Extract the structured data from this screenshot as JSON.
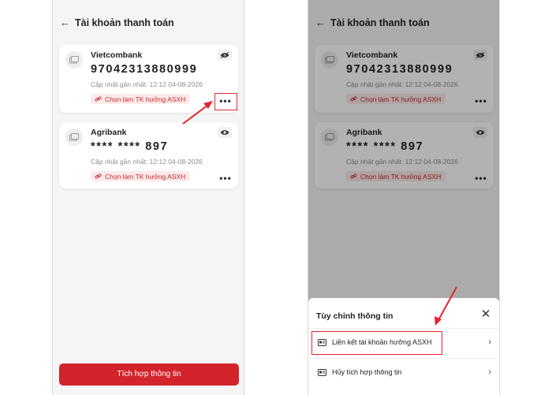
{
  "header": {
    "title": "Tài khoản thanh toán"
  },
  "accounts": [
    {
      "bank": "Vietcombank",
      "number": "9704231388099​9",
      "updated": "Cập nhật gần nhất: 12:12 04-08-2026",
      "asxh_label": "Chọn làm TK hưởng ASXH"
    },
    {
      "bank": "Agribank",
      "number": "**** **** 897",
      "updated": "Cập nhật gần nhất: 12:12 04-08-2026",
      "asxh_label": "Chọn làm TK hưởng ASXH"
    }
  ],
  "primary_button": "Tích hợp thông tin",
  "sheet": {
    "title": "Tùy chỉnh thông tin",
    "items": [
      {
        "label": "Liên kết tài khoản hưởng ASXH"
      },
      {
        "label": "Hủy tích hợp thông tin"
      }
    ]
  },
  "colors": {
    "brand_red": "#d3242b",
    "highlight_red": "#e3262d",
    "chip_bg": "#fdeaea"
  }
}
